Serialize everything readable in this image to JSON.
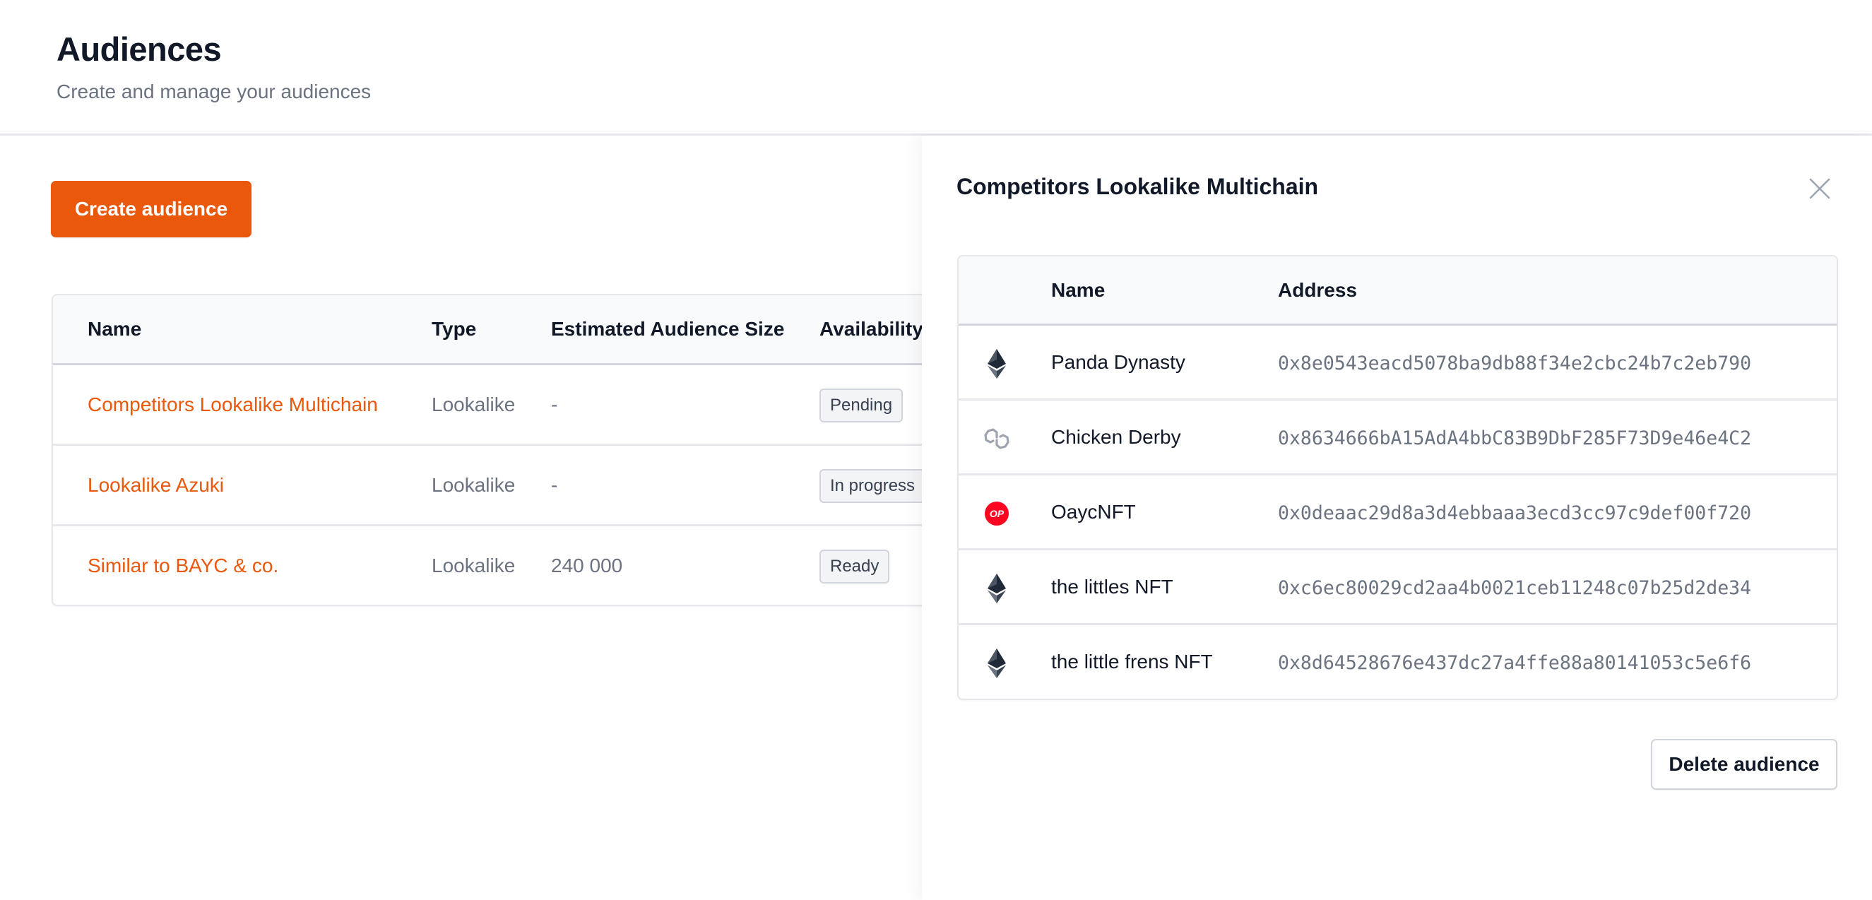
{
  "header": {
    "title": "Audiences",
    "subtitle": "Create and manage your audiences"
  },
  "toolbar": {
    "create_label": "Create audience"
  },
  "colors": {
    "accent": "#ea580c",
    "text_primary": "#111827",
    "text_muted": "#6b7280",
    "border": "#e5e7eb",
    "op_red": "#ff0420"
  },
  "audiences_table": {
    "columns": [
      "Name",
      "Type",
      "Estimated Audience Size",
      "Availability"
    ],
    "rows": [
      {
        "name": "Competitors Lookalike Multichain",
        "type": "Lookalike",
        "size": "-",
        "availability": "Pending"
      },
      {
        "name": "Lookalike Azuki",
        "type": "Lookalike",
        "size": "-",
        "availability": "In progress"
      },
      {
        "name": "Similar to BAYC & co.",
        "type": "Lookalike",
        "size": "240 000",
        "availability": "Ready"
      }
    ]
  },
  "panel": {
    "title": "Competitors Lookalike Multichain",
    "close_icon": "close-icon",
    "columns": [
      "",
      "Name",
      "Address"
    ],
    "rows": [
      {
        "chain_icon": "ethereum-icon",
        "name": "Panda Dynasty",
        "address": "0x8e0543eacd5078ba9db88f34e2cbc24b7c2eb790"
      },
      {
        "chain_icon": "polygon-icon",
        "name": "Chicken Derby",
        "address": "0x8634666bA15AdA4bbC83B9DbF285F73D9e46e4C2"
      },
      {
        "chain_icon": "optimism-icon",
        "name": "OaycNFT",
        "address": "0x0deaac29d8a3d4ebbaaa3ecd3cc97c9def00f720"
      },
      {
        "chain_icon": "ethereum-icon",
        "name": "the littles NFT",
        "address": "0xc6ec80029cd2aa4b0021ceb11248c07b25d2de34"
      },
      {
        "chain_icon": "ethereum-icon",
        "name": "the little frens NFT",
        "address": "0x8d64528676e437dc27a4ffe88a80141053c5e6f6"
      }
    ],
    "optimism_label": "OP",
    "delete_label": "Delete audience"
  }
}
